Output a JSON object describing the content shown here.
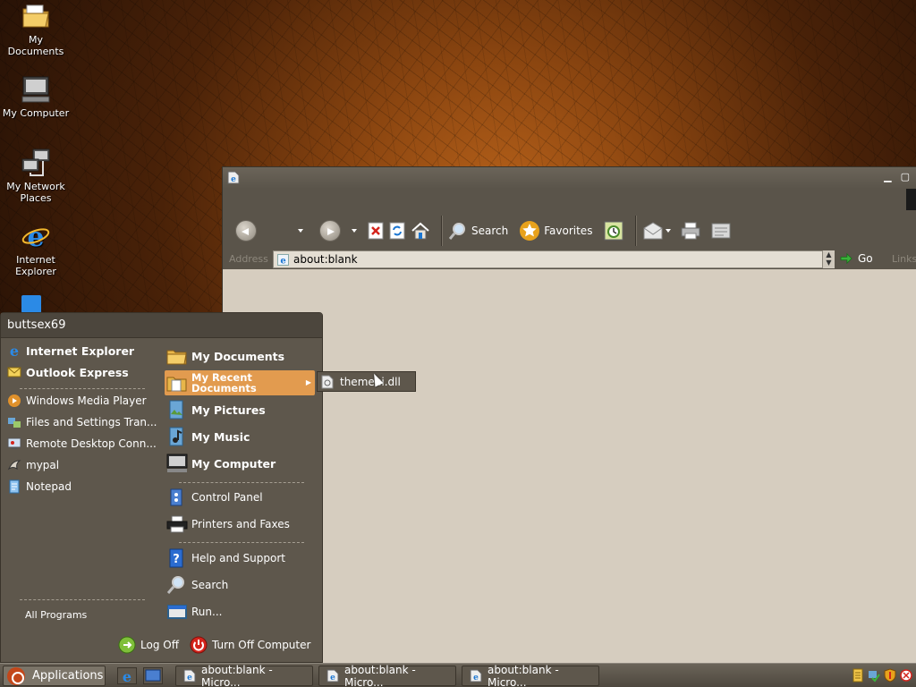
{
  "desktop": {
    "icons": [
      {
        "label": "My Documents",
        "icon": "folder-icon"
      },
      {
        "label": "My Computer",
        "icon": "computer-icon"
      },
      {
        "label": "My Network Places",
        "icon": "network-icon"
      },
      {
        "label": "Internet Explorer",
        "icon": "ie-icon"
      }
    ]
  },
  "browser": {
    "toolbar": {
      "search_label": "Search",
      "favorites_label": "Favorites"
    },
    "address": {
      "label": "Address",
      "value": "about:blank",
      "go_label": "Go",
      "links_label": "Links"
    }
  },
  "start_menu": {
    "user": "buttsex69",
    "pinned": [
      "Internet Explorer",
      "Outlook Express"
    ],
    "recent": [
      "Windows Media Player",
      "Files and Settings Tran...",
      "Remote Desktop Conn...",
      "mypal",
      "Notepad"
    ],
    "all_programs": "All Programs",
    "places": {
      "my_documents": "My Documents",
      "my_recent": "My Recent Documents",
      "my_pictures": "My Pictures",
      "my_music": "My Music",
      "my_computer": "My Computer",
      "control_panel": "Control Panel",
      "printers": "Printers and Faxes",
      "help": "Help and Support",
      "search": "Search",
      "run": "Run..."
    },
    "recent_docs_submenu": [
      "themeui.dll"
    ],
    "log_off": "Log Off",
    "turn_off": "Turn Off Computer",
    "highlight_color": "#e29b4f"
  },
  "taskbar": {
    "start_label": "Applications",
    "tasks": [
      "about:blank - Micro...",
      "about:blank - Micro...",
      "about:blank - Micro..."
    ]
  }
}
